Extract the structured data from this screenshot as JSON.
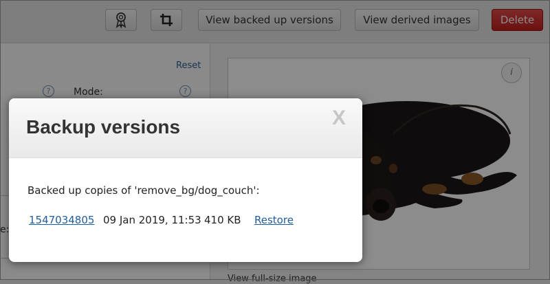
{
  "toolbar": {
    "award_icon": "award-ribbon-icon",
    "crop_icon": "crop-icon",
    "view_backed_up_label": "View backed up versions",
    "view_derived_label": "View derived images",
    "delete_label": "Delete",
    "delete_color": "#d42a2a"
  },
  "left_panel": {
    "reset_label": "Reset",
    "mode_label": "Mode:",
    "help_glyph": "?",
    "partial_label": "e:"
  },
  "preview": {
    "info_glyph": "i",
    "view_full_label": "View full-size image"
  },
  "modal": {
    "title": "Backup versions",
    "close_glyph": "X",
    "description": "Backed up copies of 'remove_bg/dog_couch':",
    "rows": [
      {
        "version": "1547034805",
        "date": "09 Jan 2019, 11:53",
        "size": "410 KB",
        "action": "Restore"
      }
    ]
  }
}
